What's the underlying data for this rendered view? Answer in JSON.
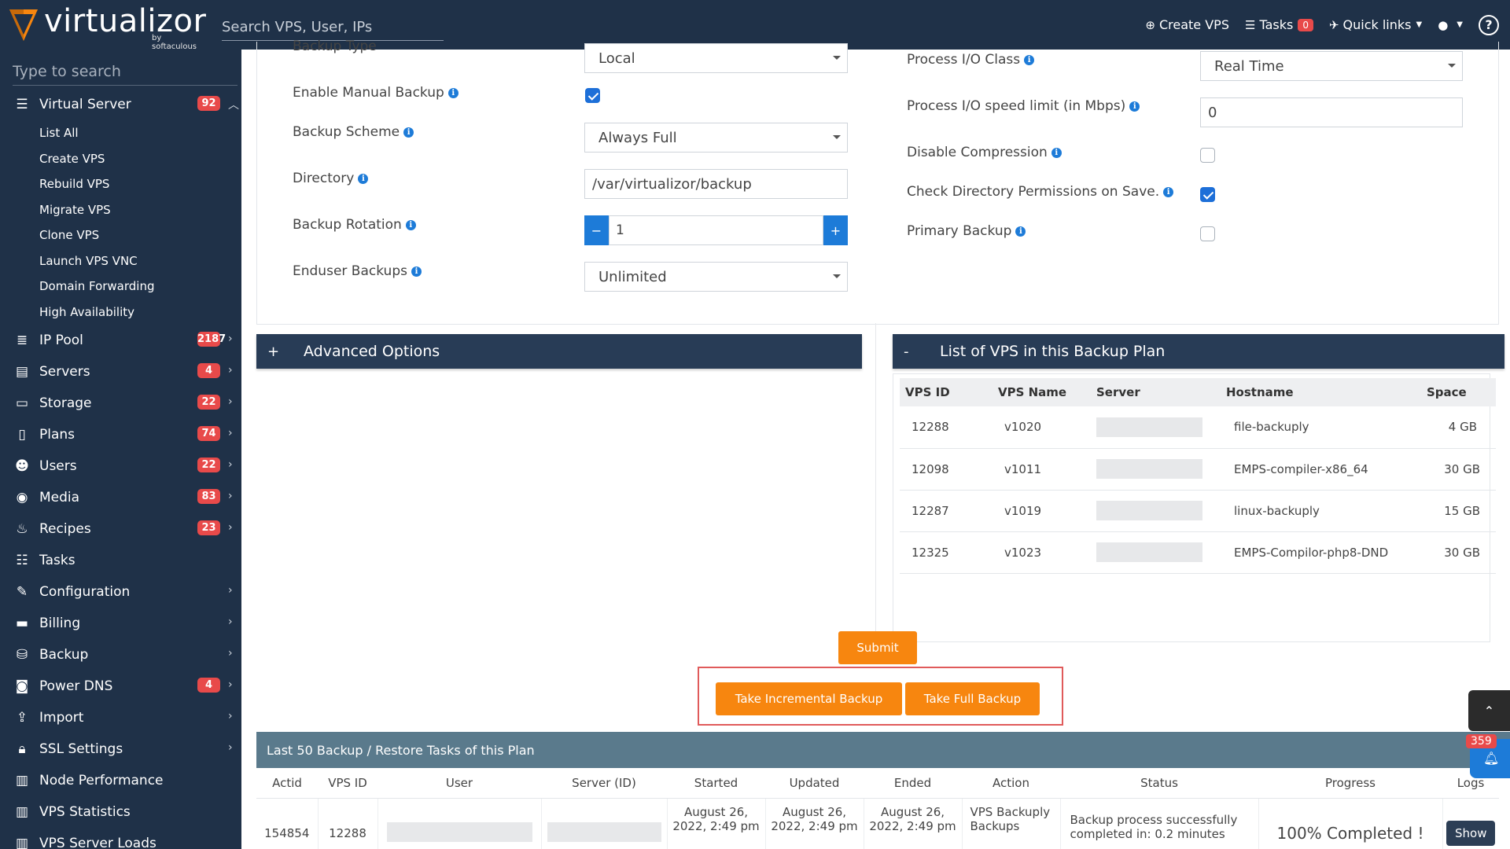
{
  "topbar": {
    "logo_text": "virtualizor",
    "logo_sub": "by softaculous",
    "search_placeholder": "Search VPS, User, IPs",
    "create_vps": "Create VPS",
    "tasks": "Tasks",
    "tasks_count": "0",
    "quick_links": "Quick links"
  },
  "sidebar": {
    "search_placeholder": "Type to search",
    "virtual_server": {
      "label": "Virtual Server",
      "badge": "92"
    },
    "sub_items": [
      "List All",
      "Create VPS",
      "Rebuild VPS",
      "Migrate VPS",
      "Clone VPS",
      "Launch VPS VNC",
      "Domain Forwarding",
      "High Availability"
    ],
    "items": [
      {
        "label": "IP Pool",
        "badge": "2187",
        "icon": "ip-pool-icon"
      },
      {
        "label": "Servers",
        "badge": "4",
        "icon": "servers-icon"
      },
      {
        "label": "Storage",
        "badge": "22",
        "icon": "storage-icon"
      },
      {
        "label": "Plans",
        "badge": "74",
        "icon": "plans-icon"
      },
      {
        "label": "Users",
        "badge": "22",
        "icon": "users-icon"
      },
      {
        "label": "Media",
        "badge": "83",
        "icon": "media-icon"
      },
      {
        "label": "Recipes",
        "badge": "23",
        "icon": "recipes-icon"
      },
      {
        "label": "Tasks",
        "badge": "",
        "icon": "tasks-icon"
      },
      {
        "label": "Configuration",
        "badge": "",
        "icon": "wrench-icon"
      },
      {
        "label": "Billing",
        "badge": "",
        "icon": "billing-icon"
      },
      {
        "label": "Backup",
        "badge": "",
        "icon": "database-icon"
      },
      {
        "label": "Power DNS",
        "badge": "4",
        "icon": "dns-icon"
      },
      {
        "label": "Import",
        "badge": "",
        "icon": "import-icon"
      },
      {
        "label": "SSL Settings",
        "badge": "",
        "icon": "lock-icon"
      },
      {
        "label": "Node Performance",
        "badge": "",
        "icon": "node-chart-icon"
      },
      {
        "label": "VPS Statistics",
        "badge": "",
        "icon": "stats-chart-icon"
      },
      {
        "label": "VPS Server Loads",
        "badge": "",
        "icon": "loads-chart-icon"
      }
    ]
  },
  "form": {
    "backup_type_label": "Backup Type",
    "backup_type_value": "Local",
    "enable_manual_label": "Enable Manual Backup",
    "scheme_label": "Backup Scheme",
    "scheme_value": "Always Full",
    "directory_label": "Directory",
    "directory_value": "/var/virtualizor/backup",
    "rotation_label": "Backup Rotation",
    "rotation_value": "1",
    "enduser_label": "Enduser Backups",
    "enduser_value": "Unlimited",
    "io_class_label": "Process I/O Class",
    "io_class_value": "Real Time",
    "io_speed_label": "Process I/O speed limit (in Mbps)",
    "io_speed_value": "0",
    "disable_compression_label": "Disable Compression",
    "check_dir_label": "Check Directory Permissions on Save.",
    "primary_backup_label": "Primary Backup"
  },
  "advanced": {
    "sign": "+",
    "title": "Advanced Options"
  },
  "vps_list": {
    "sign": "-",
    "title": "List of VPS in this Backup Plan",
    "headers": [
      "VPS ID",
      "VPS Name",
      "Server",
      "Hostname",
      "Space"
    ],
    "rows": [
      {
        "id": "12288",
        "name": "v1020",
        "host": "file-backuply",
        "space": "4 GB"
      },
      {
        "id": "12098",
        "name": "v1011",
        "host": "EMPS-compiler-x86_64",
        "space": "30 GB"
      },
      {
        "id": "12287",
        "name": "v1019",
        "host": "linux-backuply",
        "space": "15 GB"
      },
      {
        "id": "12325",
        "name": "v1023",
        "host": "EMPS-Compilor-php8-DND",
        "space": "30 GB"
      }
    ]
  },
  "buttons": {
    "submit": "Submit",
    "incremental": "Take Incremental Backup",
    "full": "Take Full Backup"
  },
  "tasks_table": {
    "title": "Last 50 Backup / Restore Tasks of this Plan",
    "headers": [
      "Actid",
      "VPS ID",
      "User",
      "Server (ID)",
      "Started",
      "Updated",
      "Ended",
      "Action",
      "Status",
      "Progress",
      "Logs"
    ],
    "row": {
      "actid": "154854",
      "vpsid": "12288",
      "started": "August 26, 2022, 2:49 pm",
      "updated": "August 26, 2022, 2:49 pm",
      "ended": "August 26, 2022, 2:49 pm",
      "action": "VPS Backuply Backups",
      "status": "Backup process successfully completed in: 0.2 minutes",
      "progress": "100% Completed !",
      "logs": "Show"
    }
  },
  "notifications": {
    "count": "359"
  },
  "colors": {
    "navy": "#1f3148",
    "orange": "#f7860f",
    "badge_red": "#e84a4a",
    "accent_blue": "#1d7bd8"
  }
}
